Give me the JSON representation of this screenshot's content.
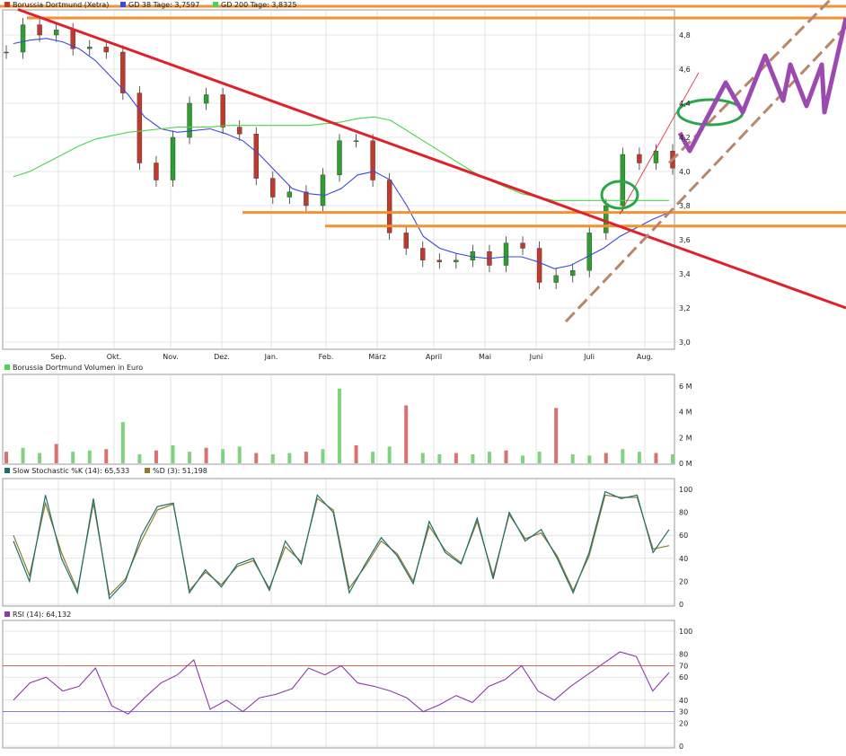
{
  "legend": {
    "main_title": "Borussia Dortmund (Xetra)",
    "ma38": "GD 38 Tage: 3,7597",
    "ma200": "GD 200 Tage: 3,8325",
    "volume_title": "Borussia Dortmund Volumen in Euro",
    "stoch_k": "Slow Stochastic %K (14): 65,533",
    "stoch_d": "%D (3): 51,198",
    "rsi": "RSI (14): 64,132"
  },
  "colors": {
    "candle_up": "#2e9f2e",
    "candle_down": "#c0392b",
    "ma38": "#3b49d8",
    "ma200": "#49d64a",
    "trend_red": "#e0202a",
    "support_orange": "#f39233",
    "channel_brown": "#b8866a",
    "projection_purple": "#9b4bb0",
    "highlight_green": "#2aa64a",
    "vol_up": "#7fd37f",
    "vol_down": "#d9726f",
    "stoch_k": "#1f6f6f",
    "stoch_d": "#8b7d2a",
    "rsi_line": "#8b3aa8",
    "rsi_overbought_fill": "#e74c3c",
    "rsi_oversold_fill": "#5a4de0",
    "grid": "#d0d0d0"
  },
  "chart_data": [
    {
      "type": "candlestick",
      "title": "Borussia Dortmund (Xetra)",
      "categories": [
        "Sep.",
        "Okt.",
        "Nov.",
        "Dez.",
        "Jan.",
        "Feb.",
        "März",
        "April",
        "Mai",
        "Juni",
        "Juli",
        "Aug."
      ],
      "ylim": [
        3.0,
        4.9
      ],
      "yticks": [
        "3,0",
        "3,2",
        "3,4",
        "3,6",
        "3,8",
        "4,0",
        "4,2",
        "4,4",
        "4,6",
        "4,8"
      ],
      "series": [
        {
          "name": "Borussia Dortmund (Xetra)",
          "close": [
            4.7,
            4.86,
            4.8,
            4.83,
            4.72,
            4.73,
            4.7,
            4.46,
            4.05,
            3.95,
            4.2,
            4.4,
            4.45,
            4.26,
            4.22,
            3.96,
            3.85,
            3.88,
            3.8,
            3.98,
            4.18,
            4.18,
            3.95,
            3.64,
            3.55,
            3.48,
            3.47,
            3.48,
            3.53,
            3.45,
            3.58,
            3.55,
            3.35,
            3.39,
            3.42,
            3.64,
            3.8,
            4.1,
            4.05,
            4.12,
            4.02
          ]
        },
        {
          "name": "GD 38 Tage",
          "values": [
            4.75,
            4.77,
            4.78,
            4.76,
            4.72,
            4.65,
            4.55,
            4.45,
            4.32,
            4.25,
            4.23,
            4.24,
            4.25,
            4.22,
            4.18,
            4.1,
            4.0,
            3.9,
            3.87,
            3.86,
            3.9,
            3.98,
            4.0,
            3.95,
            3.8,
            3.62,
            3.55,
            3.52,
            3.5,
            3.49,
            3.5,
            3.5,
            3.47,
            3.43,
            3.45,
            3.5,
            3.55,
            3.62,
            3.67,
            3.72,
            3.76
          ]
        },
        {
          "name": "GD 200 Tage",
          "values": [
            3.97,
            4.0,
            4.05,
            4.1,
            4.15,
            4.19,
            4.21,
            4.23,
            4.24,
            4.25,
            4.26,
            4.26,
            4.26,
            4.27,
            4.27,
            4.27,
            4.27,
            4.27,
            4.27,
            4.28,
            4.29,
            4.31,
            4.32,
            4.3,
            4.24,
            4.18,
            4.12,
            4.06,
            4.0,
            3.95,
            3.91,
            3.87,
            3.85,
            3.83,
            3.83,
            3.83,
            3.83,
            3.83,
            3.83,
            3.83,
            3.83
          ]
        }
      ]
    },
    {
      "type": "bar",
      "title": "Borussia Dortmund Volumen in Euro",
      "ylim": [
        0,
        6
      ],
      "yticks": [
        "0 M",
        "2 M",
        "4 M",
        "6 M"
      ],
      "series": [
        {
          "name": "Volumen",
          "values": [
            0.9,
            1.2,
            0.8,
            1.5,
            0.9,
            1.0,
            1.1,
            3.2,
            0.7,
            1.0,
            1.4,
            0.9,
            1.2,
            1.1,
            1.3,
            0.8,
            0.7,
            0.8,
            0.9,
            1.1,
            5.8,
            1.4,
            0.9,
            1.3,
            4.5,
            0.8,
            0.7,
            0.8,
            0.7,
            0.9,
            1.0,
            0.6,
            0.9,
            4.3,
            0.7,
            0.6,
            0.8,
            1.1,
            0.9,
            0.8,
            0.7
          ]
        }
      ]
    },
    {
      "type": "line",
      "title": "Slow Stochastic",
      "ylim": [
        0,
        100
      ],
      "yticks": [
        "0",
        "20",
        "40",
        "60",
        "80",
        "100"
      ],
      "series": [
        {
          "name": "Slow Stochastic %K (14): 65,533",
          "values": [
            55,
            20,
            95,
            40,
            10,
            92,
            5,
            20,
            60,
            85,
            88,
            10,
            30,
            15,
            35,
            40,
            12,
            55,
            35,
            95,
            80,
            10,
            35,
            58,
            42,
            18,
            72,
            45,
            35,
            75,
            22,
            80,
            55,
            65,
            40,
            10,
            45,
            98,
            92,
            95,
            45,
            65
          ]
        },
        {
          "name": "%D (3): 51,198",
          "values": [
            60,
            25,
            88,
            45,
            12,
            88,
            8,
            22,
            55,
            82,
            87,
            12,
            28,
            17,
            33,
            38,
            14,
            50,
            37,
            92,
            82,
            14,
            33,
            55,
            44,
            20,
            68,
            47,
            36,
            72,
            25,
            78,
            57,
            62,
            42,
            12,
            42,
            95,
            93,
            93,
            48,
            51
          ]
        }
      ]
    },
    {
      "type": "line",
      "title": "RSI (14)",
      "ylim": [
        0,
        100
      ],
      "yticks": [
        "0",
        "20",
        "40",
        "60",
        "80",
        "100"
      ],
      "series": [
        {
          "name": "RSI (14): 64,132",
          "values": [
            40,
            55,
            60,
            48,
            52,
            68,
            35,
            28,
            42,
            55,
            62,
            75,
            32,
            40,
            30,
            42,
            45,
            50,
            68,
            62,
            70,
            55,
            52,
            48,
            42,
            30,
            36,
            44,
            38,
            52,
            58,
            70,
            48,
            40,
            52,
            62,
            72,
            82,
            78,
            48,
            64
          ]
        }
      ],
      "reference_lines": [
        70,
        30
      ]
    }
  ]
}
